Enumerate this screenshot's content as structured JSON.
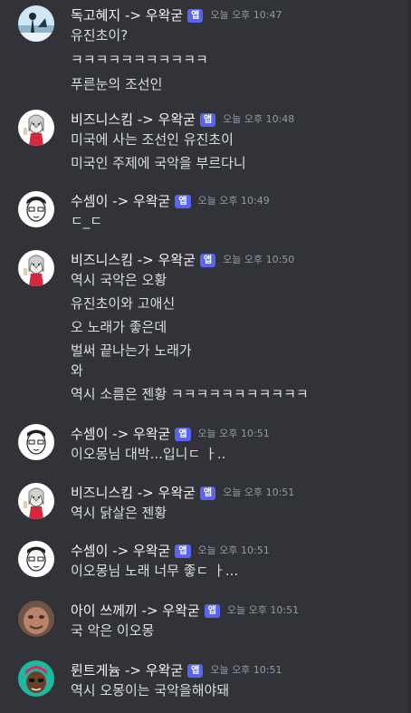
{
  "messages": [
    {
      "author": "독고혜지 -> 우왁굳",
      "badge": "앱",
      "time": "오늘 오후 10:47",
      "lines": [
        "유진초이?",
        "ㅋㅋㅋㅋㅋㅋㅋㅋㅋㅋㅋ",
        "푸른눈의 조선인"
      ]
    },
    {
      "author": "비즈니스킴 -> 우왁굳",
      "badge": "앱",
      "time": "오늘 오후 10:48",
      "lines": [
        "미국에 사는 조선인 유진초이",
        "미국인 주제에 국악을 부르다니"
      ]
    },
    {
      "author": "수셈이 -> 우왁굳",
      "badge": "앱",
      "time": "오늘 오후 10:49",
      "lines": [
        "ㄷ_ㄷ"
      ]
    },
    {
      "author": "비즈니스킴 -> 우왁굳",
      "badge": "앱",
      "time": "오늘 오후 10:50",
      "lines": [
        "역시 국악은 오황",
        "유진초이와 고애신",
        "오 노래가 좋은데",
        "벌써 끝나는가 노래가",
        "와",
        "역시 소름은 젠황 ㅋㅋㅋㅋㅋㅋㅋㅋㅋㅋㅋ"
      ]
    },
    {
      "author": "수셈이 -> 우왁굳",
      "badge": "앱",
      "time": "오늘 오후 10:51",
      "lines": [
        "이오몽님 대박...입니ㄷ ㅏ.."
      ]
    },
    {
      "author": "비즈니스킴 -> 우왁굳",
      "badge": "앱",
      "time": "오늘 오후 10:51",
      "lines": [
        "역시 닭살은 젠황"
      ]
    },
    {
      "author": "수셈이 -> 우왁굳",
      "badge": "앱",
      "time": "오늘 오후 10:51",
      "lines": [
        "이오몽님 노래 너무 좋ㄷ ㅏ..."
      ]
    },
    {
      "author": "아이 쓰께끼 -> 우왁굳",
      "badge": "앱",
      "time": "오늘 오후 10:51",
      "lines": [
        "국 악은 이오몽"
      ]
    },
    {
      "author": "륀트게늄 -> 우왁굳",
      "badge": "앱",
      "time": "오늘 오후 10:51",
      "lines": [
        "역시 오몽이는 국악을해야돼"
      ]
    }
  ]
}
